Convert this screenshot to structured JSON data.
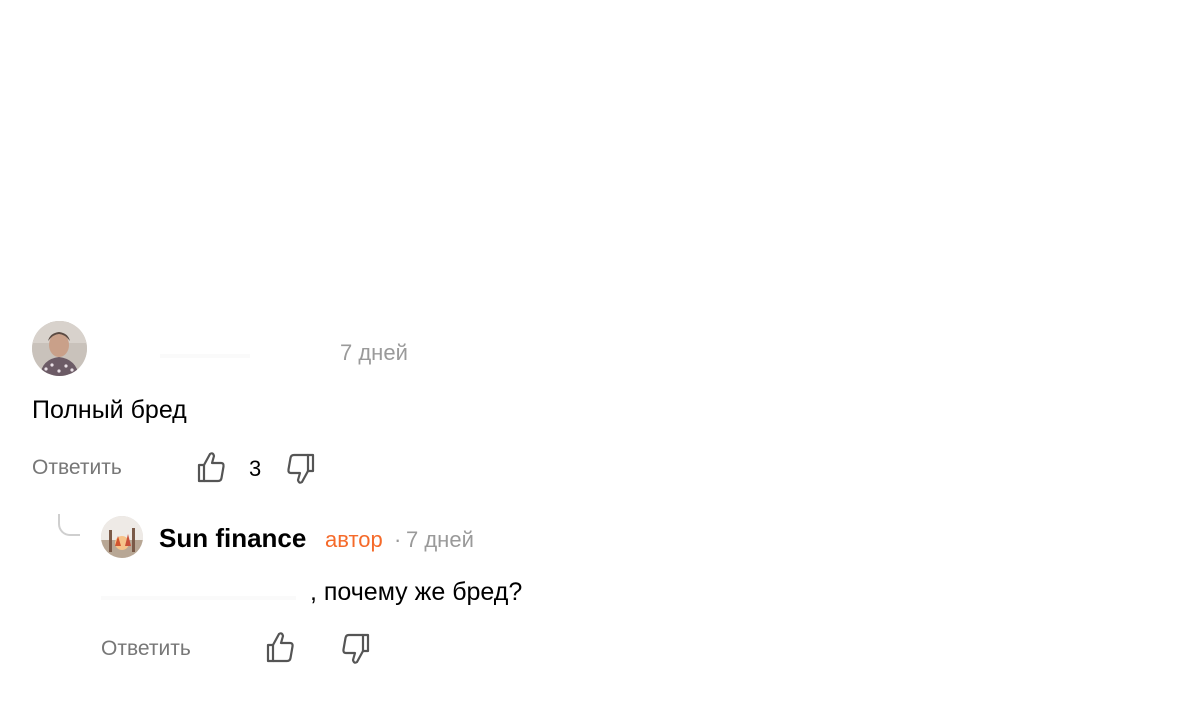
{
  "comment": {
    "time": "7 дней",
    "text": "Полный бред",
    "reply_label": "Ответить",
    "likes": "3",
    "avatar_icon": "user-avatar"
  },
  "reply": {
    "author": "Sun finance",
    "badge": "автор",
    "separator": "·",
    "time": "7 дней",
    "text": ", почему же бред?",
    "reply_label": "Ответить",
    "avatar_icon": "channel-avatar"
  },
  "colors": {
    "accent": "#f56a2a",
    "muted": "#9a9a9a",
    "action": "#777777"
  },
  "icons": {
    "like": "thumbs-up-icon",
    "dislike": "thumbs-down-icon",
    "thread": "reply-thread-line"
  }
}
